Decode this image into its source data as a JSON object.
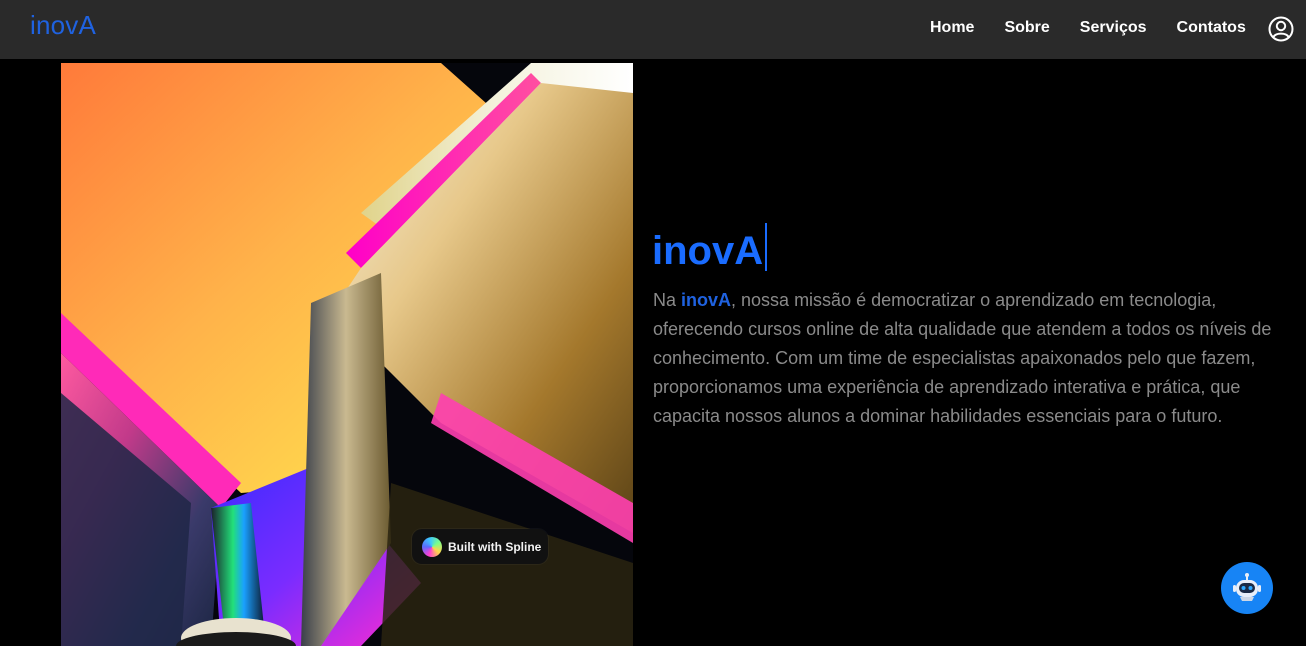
{
  "header": {
    "brand": "inovA",
    "nav": [
      {
        "label": "Home"
      },
      {
        "label": "Sobre"
      },
      {
        "label": "Serviços"
      },
      {
        "label": "Contatos"
      }
    ],
    "user_icon": "user-circle-icon"
  },
  "hero": {
    "badge_text": "Built with Spline",
    "badge_icon": "spline-logo-icon",
    "title": "inovA",
    "paragraph": {
      "prefix": "Na ",
      "highlight": "inovA",
      "suffix": ", nossa missão é democratizar o aprendizado em tecnologia, oferecendo cursos online de alta qualidade que atendem a todos os níveis de conhecimento. Com um time de especialistas apaixonados pelo que fazem, proporcionamos uma experiência de aprendizado interativa e prática, que capacita nossos alunos a dominar habilidades essenciais para o futuro."
    }
  },
  "chatbot": {
    "icon": "robot-icon"
  },
  "colors": {
    "accent": "#1f62e0",
    "navbar_bg": "#2a2a2a",
    "page_bg": "#000000",
    "body_text": "#8a8a8a",
    "chatbot_bg": "#1784f5"
  }
}
